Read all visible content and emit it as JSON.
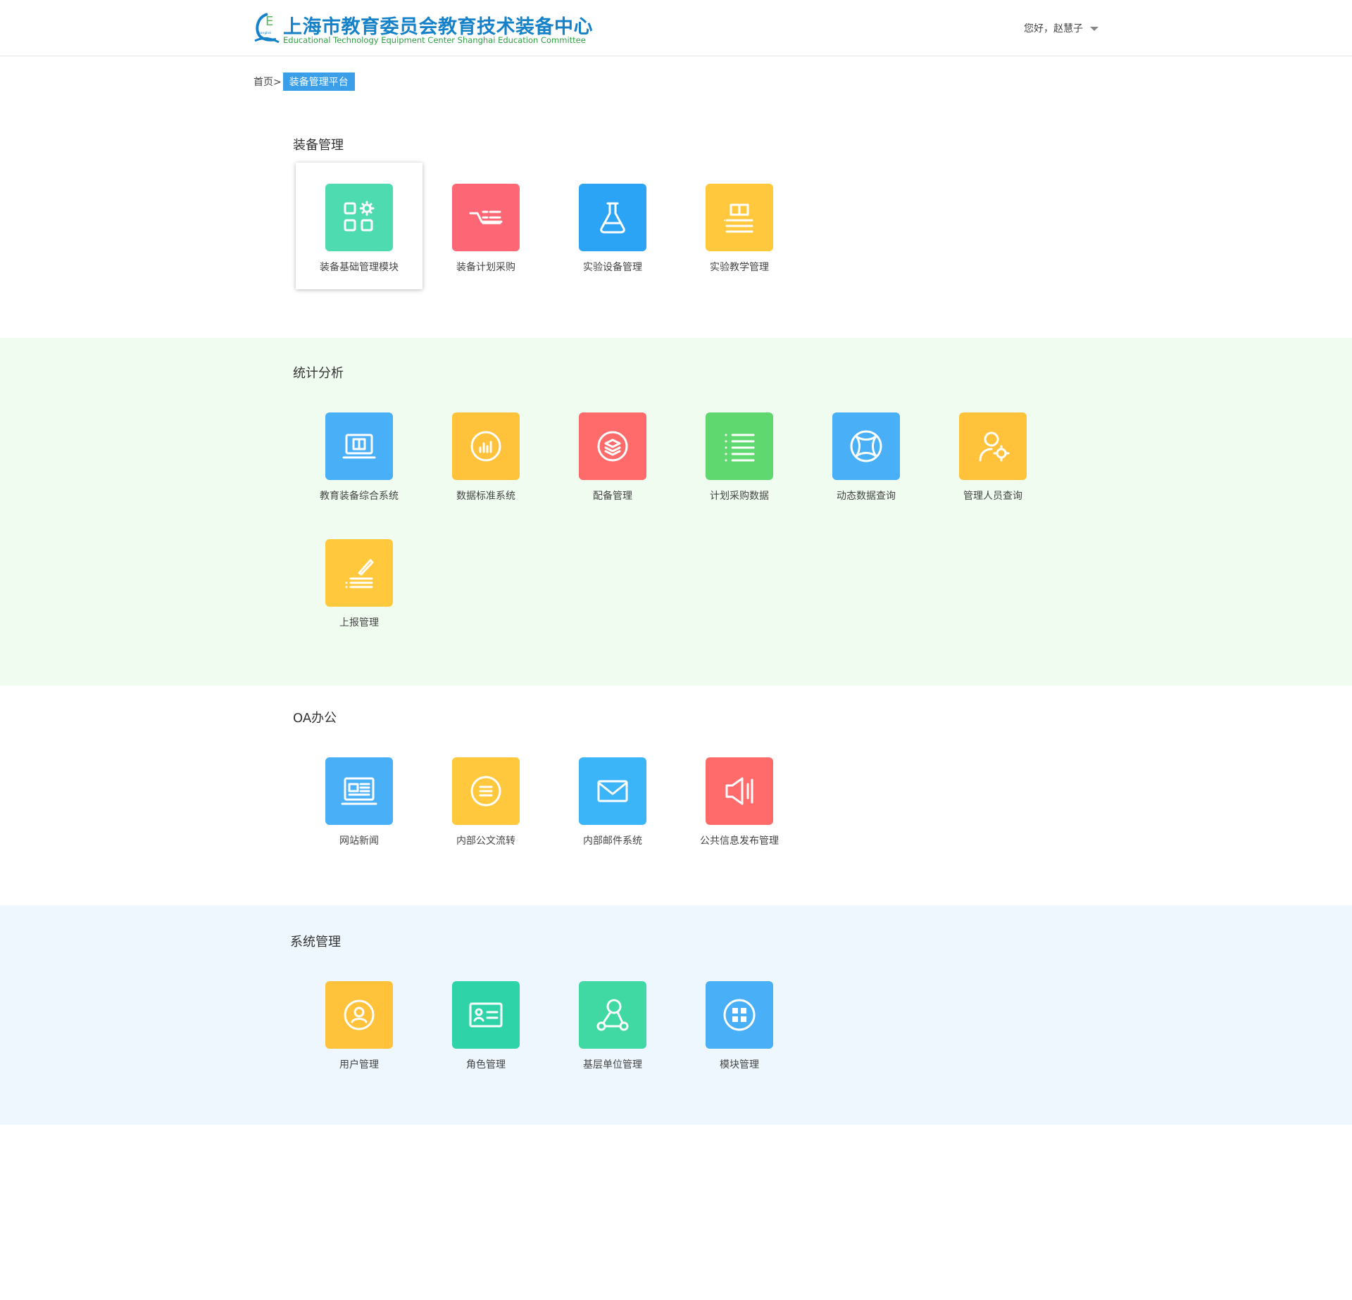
{
  "header": {
    "logo_letter": "E",
    "logo_small": "Shanghai",
    "title_cn": "上海市教育委员会教育技术装备中心",
    "title_en": "Educational Technology Equipment Center Shanghai Education Committee",
    "greeting": "您好，赵慧子"
  },
  "breadcrumb": {
    "home": "首页>",
    "current": "装备管理平台"
  },
  "colors": {
    "green": "#4fdbb0",
    "red": "#fc6675",
    "blue": "#2ba4f5",
    "yellow": "#ffc83d",
    "lightgreen": "#5fd96f",
    "lightblue": "#49aff7",
    "coral": "#ff6b6b",
    "teal": "#2ed3a8",
    "band_green": "#f1fcf1",
    "band_blue": "#eef7fd"
  },
  "sections": [
    {
      "title": "装备管理",
      "items": [
        {
          "label": "装备基础管理模块",
          "icon": "apps-gear-icon",
          "color": "#4fdbb0",
          "active": true
        },
        {
          "label": "装备计划采购",
          "icon": "truck-list-icon",
          "color": "#fc6675"
        },
        {
          "label": "实验设备管理",
          "icon": "flask-icon",
          "color": "#2ba4f5"
        },
        {
          "label": "实验教学管理",
          "icon": "book-list-icon",
          "color": "#ffc83d"
        }
      ]
    },
    {
      "title": "统计分析",
      "items": [
        {
          "label": "教育装备综合系统",
          "icon": "laptop-book-icon",
          "color": "#49aff7"
        },
        {
          "label": "数据标准系统",
          "icon": "bar-chart-circle-icon",
          "color": "#ffc23a"
        },
        {
          "label": "配备管理",
          "icon": "layers-circle-icon",
          "color": "#ff6b6b"
        },
        {
          "label": "计划采购数据",
          "icon": "list-icon",
          "color": "#5fd96f"
        },
        {
          "label": "动态数据查询",
          "icon": "cross-circle-icon",
          "color": "#49aff7"
        },
        {
          "label": "管理人员查询",
          "icon": "user-gear-icon",
          "color": "#ffc23a"
        },
        {
          "label": "上报管理",
          "icon": "pen-list-icon",
          "color": "#ffc83d"
        }
      ]
    },
    {
      "title": "OA办公",
      "items": [
        {
          "label": "网站新闻",
          "icon": "monitor-news-icon",
          "color": "#49aff7"
        },
        {
          "label": "内部公文流转",
          "icon": "document-circle-icon",
          "color": "#ffc83d"
        },
        {
          "label": "内部邮件系统",
          "icon": "mail-icon",
          "color": "#3bb5f8"
        },
        {
          "label": "公共信息发布管理",
          "icon": "speaker-icon",
          "color": "#ff6b6b"
        }
      ]
    },
    {
      "title": "系统管理",
      "items": [
        {
          "label": "用户管理",
          "icon": "user-circle-icon",
          "color": "#ffc23a"
        },
        {
          "label": "角色管理",
          "icon": "id-card-icon",
          "color": "#2ed3a8"
        },
        {
          "label": "基层单位管理",
          "icon": "network-nodes-icon",
          "color": "#41d9a3"
        },
        {
          "label": "模块管理",
          "icon": "grid-circle-icon",
          "color": "#49aff7"
        }
      ]
    }
  ]
}
